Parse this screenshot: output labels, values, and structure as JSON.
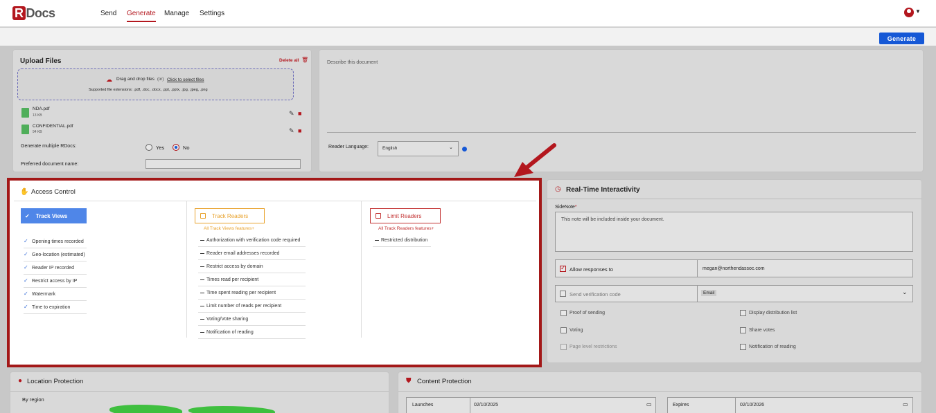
{
  "nav": {
    "logo_r": "R",
    "logo_rest": "Docs",
    "items": [
      "Send",
      "Generate",
      "Manage",
      "Settings"
    ],
    "active": "Generate"
  },
  "generate_button": "Generate",
  "upload": {
    "title": "Upload Files",
    "delete_all": "Delete all",
    "drop_text": "Drag and drop files",
    "or_text": "(or)",
    "click_text": "Click to select files",
    "supported": "Supported file extensions: .pdf, .doc, .docx, .ppt, .pptx, .jpg, .jpeg, .png",
    "files": [
      {
        "name": "NDA.pdf",
        "size": "13 KB"
      },
      {
        "name": "CONFIDENTIAL.pdf",
        "size": "94 KB"
      }
    ],
    "multiple_label": "Generate multiple RDocs:",
    "yes": "Yes",
    "no": "No",
    "preferred_label": "Preferred document name:"
  },
  "describe": {
    "placeholder": "Describe this document",
    "reader_language_label": "Reader Language:",
    "reader_language_value": "English"
  },
  "access_control": {
    "title": "Access Control",
    "track_views": {
      "label": "Track Views",
      "features": [
        "Opening times recorded",
        "Geo-location (estimated)",
        "Reader IP recorded",
        "Restrict access by IP",
        "Watermark",
        "Time to expiration"
      ]
    },
    "track_readers": {
      "label": "Track Readers",
      "sub": "All Track Views features+",
      "features": [
        "Authorization with verification code required",
        "Reader email addresses recorded",
        "Restrict access by domain",
        "Times read per recipient",
        "Time spent reading per recipient",
        "Limit number of reads per recipient",
        "Voting/Vote sharing",
        "Notification of reading"
      ]
    },
    "limit_readers": {
      "label": "Limit Readers",
      "sub": "All Track Readers features+",
      "features": [
        "Restricted distribution"
      ]
    }
  },
  "realtime": {
    "title": "Real-Time Interactivity",
    "sidenote_label": "SideNote",
    "sidenote_required": "*",
    "sidenote_text": "This note will be included inside your document.",
    "allow_responses_label": "Allow responses to",
    "allow_responses_email": "megan@northendassoc.com",
    "send_verification_label": "Send verification code",
    "verification_method": "Email",
    "options_left": [
      "Proof of sending",
      "Voting",
      "Page level restrictions"
    ],
    "options_right": [
      "Display distribution list",
      "Share votes",
      "Notification of reading"
    ]
  },
  "location": {
    "title": "Location Protection",
    "by_region": "By region"
  },
  "content": {
    "title": "Content Protection",
    "launches_label": "Launches",
    "launches_value": "02/10/2025",
    "expires_label": "Expires",
    "expires_value": "02/10/2026"
  },
  "colors": {
    "brand_red": "#b3171e",
    "primary_blue": "#1558d6",
    "track_views_blue": "#4f86e8",
    "track_readers_orange": "#e8a12a",
    "limit_readers_red": "#c23030"
  }
}
